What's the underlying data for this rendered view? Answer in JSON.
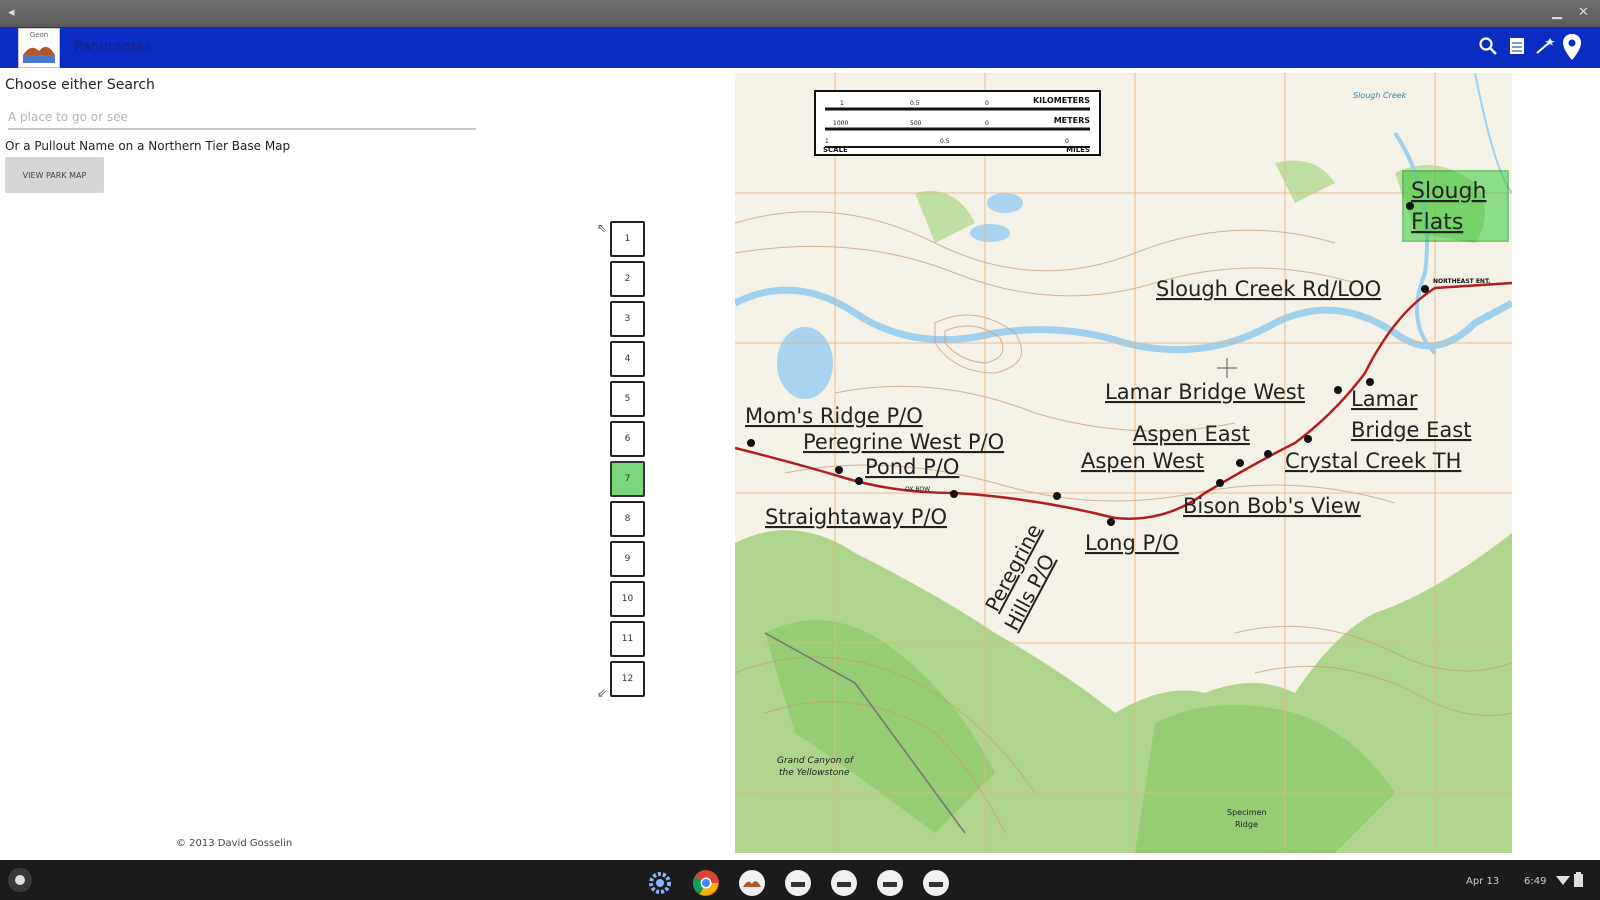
{
  "app": {
    "title": "Panoramas",
    "logo_text": "Geon"
  },
  "left": {
    "choose_label": "Choose either Search",
    "search_placeholder": "A place to go or see",
    "pullout_label": "Or a Pullout Name on a Northern Tier Base Map",
    "view_map_label": "VIEW PARK MAP",
    "copyright": "© 2013 David Gosselin"
  },
  "panoramas": {
    "items": [
      "1",
      "2",
      "3",
      "4",
      "5",
      "6",
      "7",
      "8",
      "9",
      "10",
      "11",
      "12"
    ],
    "selected": "7"
  },
  "map": {
    "scale_bar": {
      "kilometers": "KILOMETERS",
      "meters": "METERS",
      "scale": "SCALE",
      "miles": "MILES",
      "km_ticks": [
        "1",
        "0.5",
        "0"
      ],
      "m_ticks": [
        "1000",
        "500",
        "0"
      ],
      "mi_ticks": [
        "1",
        "0.5",
        "0"
      ]
    },
    "labels": {
      "slough_flats_1": "Slough",
      "slough_flats_2": "Flats",
      "slough_creek_rd": "Slough Creek Rd/LOO",
      "lamar_bridge_west": "Lamar Bridge West",
      "lamar_bridge_east_1": "Lamar",
      "lamar_bridge_east_2": "Bridge East",
      "moms_ridge": "Mom's Ridge P/O",
      "peregrine_west": "Peregrine West P/O",
      "pond": "Pond P/O",
      "aspen_east": "Aspen East",
      "aspen_west": "Aspen West",
      "crystal_creek": "Crystal Creek TH",
      "bison_bobs_view": "Bison Bob's View",
      "straightaway": "Straightaway P/O",
      "long": "Long P/O",
      "peregrine_hills_1": "Peregrine",
      "peregrine_hills_2": "Hills P/O",
      "grand_canyon_1": "Grand Canyon of",
      "grand_canyon_2": "the Yellowstone",
      "specimen_ridge_1": "Specimen",
      "specimen_ridge_2": "Ridge",
      "slough_creek_water": "Slough Creek",
      "road_sign": "NORTHEAST ENT.",
      "pond_sign": "OX BOW"
    },
    "colors": {
      "road": "#b01e1e",
      "forest": "#9fcf7a",
      "water": "#a9d3ee",
      "highlight": "#27c127",
      "grid": "#f0b070",
      "contour": "#c9986d"
    }
  },
  "taskbar": {
    "date": "Apr 13",
    "time": "6:49"
  }
}
